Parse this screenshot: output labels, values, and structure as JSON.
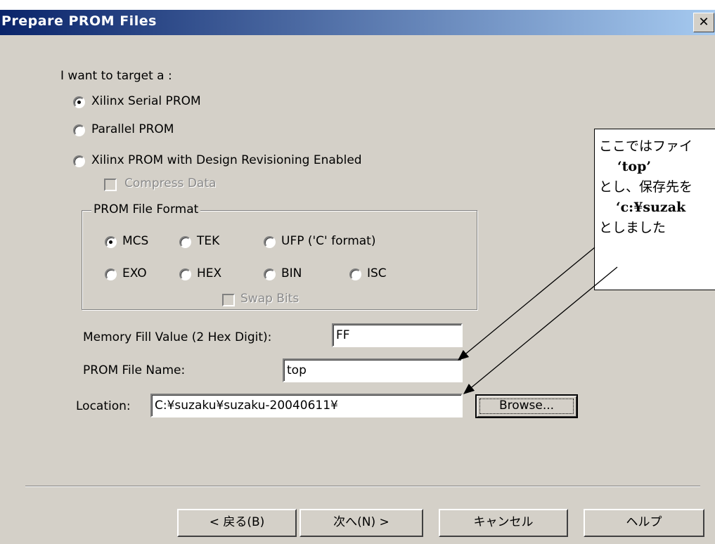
{
  "window": {
    "title": "Prepare PROM Files",
    "close_glyph": "✕"
  },
  "target": {
    "label": "I want to target a :",
    "options": [
      {
        "label": "Xilinx Serial PROM",
        "checked": true
      },
      {
        "label": "Parallel PROM",
        "checked": false
      },
      {
        "label": "Xilinx PROM with Design Revisioning Enabled",
        "checked": false
      }
    ],
    "compress_label": "Compress Data"
  },
  "format": {
    "legend": "PROM File Format",
    "options": [
      {
        "label": "MCS",
        "checked": true
      },
      {
        "label": "TEK",
        "checked": false
      },
      {
        "label": "UFP ('C' format)",
        "checked": false
      },
      {
        "label": "EXO",
        "checked": false
      },
      {
        "label": "HEX",
        "checked": false
      },
      {
        "label": "BIN",
        "checked": false
      },
      {
        "label": "ISC",
        "checked": false
      }
    ],
    "swap_label": "Swap Bits"
  },
  "fields": {
    "fill_label": "Memory Fill Value (2 Hex Digit):",
    "fill_value": "FF",
    "name_label": "PROM File Name:",
    "name_value": "top",
    "location_label": "Location:",
    "location_value": "C:¥suzaku¥suzaku-20040611¥",
    "browse_label": "Browse..."
  },
  "footer": {
    "back_label": "< 戻る(B)",
    "next_label": "次へ(N) >",
    "cancel_label": "キャンセル",
    "help_label": "ヘルプ"
  },
  "callout": {
    "line1": "ここではファイ",
    "line2": "‘top’",
    "line3": "とし、保存先を",
    "line4": "‘c:¥suzak",
    "line5": "としました"
  },
  "colors": {
    "title_start": "#0a246a",
    "title_end": "#a6caf0",
    "face": "#d4d0c8"
  }
}
